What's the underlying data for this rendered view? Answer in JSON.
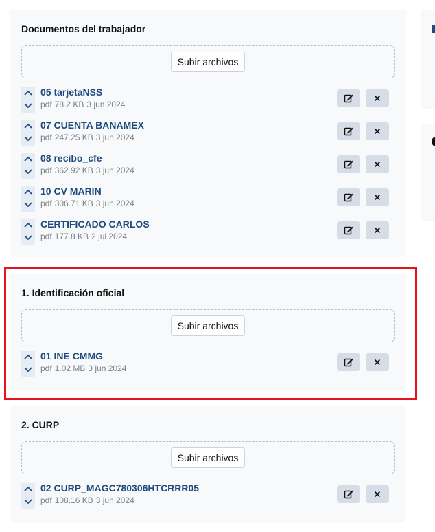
{
  "cards": [
    {
      "title": "Documentos del trabajador",
      "upload_label": "Subir archivos",
      "files": [
        {
          "name": "05 tarjetaNSS",
          "type": "pdf",
          "size": "78.2 KB",
          "date": "3 jun 2024"
        },
        {
          "name": "07 CUENTA BANAMEX",
          "type": "pdf",
          "size": "247.25 KB",
          "date": "3 jun 2024"
        },
        {
          "name": "08 recibo_cfe",
          "type": "pdf",
          "size": "362.92 KB",
          "date": "3 jun 2024"
        },
        {
          "name": "10 CV MARIN",
          "type": "pdf",
          "size": "306.71 KB",
          "date": "3 jun 2024"
        },
        {
          "name": "CERTIFICADO CARLOS",
          "type": "pdf",
          "size": "177.8 KB",
          "date": "2 jul 2024"
        }
      ]
    },
    {
      "title": "1. Identificación oficial",
      "upload_label": "Subir archivos",
      "files": [
        {
          "name": "01 INE CMMG",
          "type": "pdf",
          "size": "1.02 MB",
          "date": "3 jun 2024"
        }
      ]
    },
    {
      "title": "2. CURP",
      "upload_label": "Subir archivos",
      "files": [
        {
          "name": "02 CURP_MAGC780306HTCRRR05",
          "type": "pdf",
          "size": "108.16 KB",
          "date": "3 jun 2024"
        }
      ]
    }
  ],
  "colors": {
    "file_link": "#1f4a7e",
    "action_button_bg": "#d6dde7",
    "highlight_border": "#e5141a",
    "card_bg": "#f7f9fb"
  },
  "icons": {
    "move_up": "chevron-up-icon",
    "move_down": "chevron-down-icon",
    "edit": "edit-icon",
    "delete": "close-icon"
  }
}
